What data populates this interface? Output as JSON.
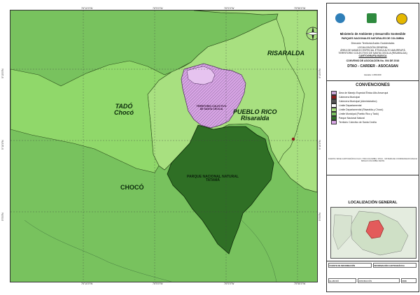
{
  "map": {
    "labels": {
      "risaralda": "RISARALDA",
      "tado": "TADÓ\nChocó",
      "pueblo_rico": "PUEBLO RICO\nRisaralda",
      "choco": "CHOCÓ",
      "pnn_tatama": "PARQUE NACIONAL NATURAL TATAMÁ",
      "territorio": "TERRITORIO COLECTIVO DE SANTA CECILIA"
    },
    "coordinates": {
      "top": [
        "76°10'0\"W",
        "76°5'0\"W",
        "76°0'0\"W",
        "75°55'0\"W"
      ],
      "bottom": [
        "76°10'0\"W",
        "76°5'0\"W",
        "76°0'0\"W",
        "75°55'0\"W"
      ],
      "left": [
        "5°15'0\"N",
        "5°10'0\"N",
        "5°5'0\"N"
      ],
      "right": [
        "5°15'0\"N",
        "5°10'0\"N",
        "5°5'0\"N"
      ]
    },
    "colors": {
      "choco": "#78c25e",
      "risaralda": "#a8e080",
      "pnn": "#2f6f25",
      "territorio": "#d9a6e6"
    }
  },
  "header": {
    "ministry": "Ministerio de Ambiente y Desarrollo Sostenible",
    "pnn": "PARQUES NACIONALES NATURALES DE COLOMBIA",
    "direction": "Dirección Territorial Andes Occidentales",
    "localization": "LOCALIZACIÓN GENERAL",
    "area": "ÁREA DE MANEJO ESPECIAL ÉTNICA ALTO AMURRUPÁ",
    "territory": "TERRITORIO COLECTIVO DE SANTA CECILIA (RISARALDA)",
    "cartography": "CARTOGRAFÍA BÁSICA",
    "convenio": "CONVENIO DE ASOCIACIÓN No. 004 DE 2016",
    "org": "DTAO - CARDER - ASOCASAN",
    "escala": "Escala: 1:250.000"
  },
  "legend": {
    "title": "CONVENCIONES",
    "items": [
      {
        "label": "Área de Manejo Especial Étnica Alto Amurrupá",
        "color": "#c9a6d6"
      },
      {
        "label": "Cabecera Municipal",
        "color": "#8b1a1a"
      },
      {
        "label": "Cabecera Municipal (Administrativo)",
        "color": "#555555"
      },
      {
        "label": "Límite Departamental",
        "color": "#ffffff"
      },
      {
        "label": "Límite Departamental (Risaralda y Chocó)",
        "color": "#a8e080"
      },
      {
        "label": "Límite Municipal (Pueblo Rico y Tadó)",
        "color": "#78c25e"
      },
      {
        "label": "Parque Nacional Natural",
        "color": "#2f6f25"
      },
      {
        "label": "Territorio Colectivo de Santa Cecilia",
        "color": "#d9a6e6"
      }
    ],
    "notes": "FUENTE: BASE CARTOGRÁFICA IGAC / PNN COLOMBIA / DTAO - SISTEMA DE COORDENADAS MAGNA SIRGAS COLOMBIA OESTE"
  },
  "location": {
    "title": "LOCALIZACIÓN GENERAL"
  },
  "footer": {
    "fuente": "FUENTE DE INFORMACIÓN",
    "info": "INFORMACIÓN CARTOGRÁFICA",
    "elaboro": "ELABORÓ",
    "aprobacion": "APROBACIÓN",
    "year": "2016"
  }
}
